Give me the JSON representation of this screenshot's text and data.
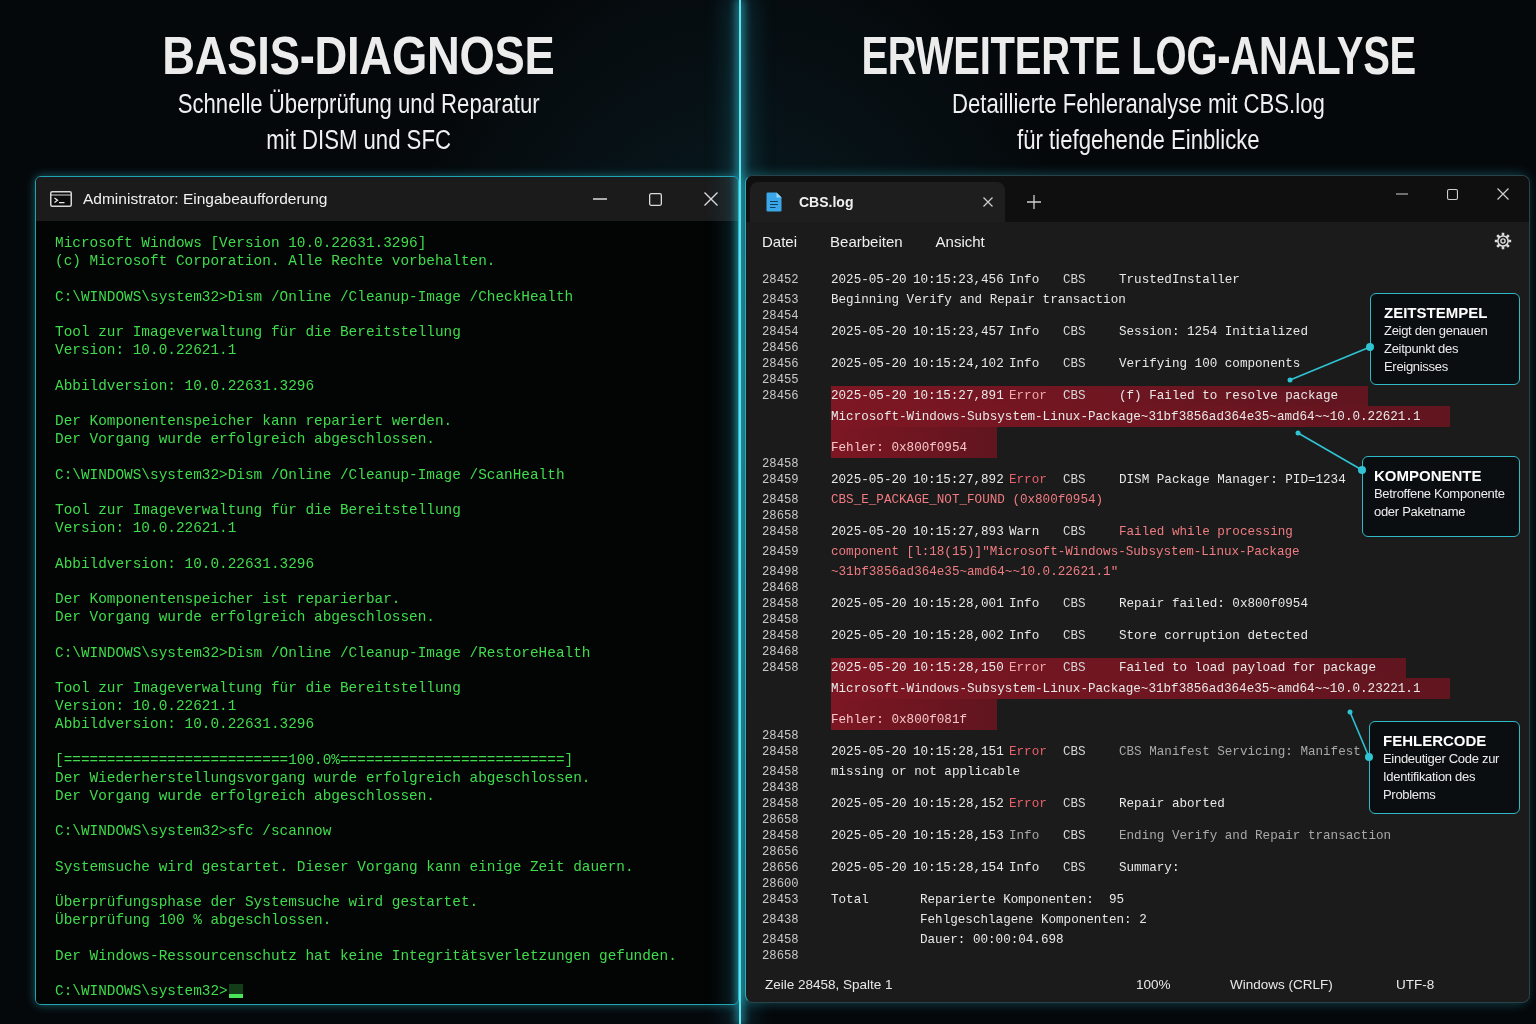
{
  "left_panel": {
    "heading": "BASIS-DIAGNOSE",
    "subheading": "Schnelle Überprüfung und Reparatur\nmit DISM und SFC",
    "terminal": {
      "title": "Administrator: Eingabeaufforderung",
      "cursor": true,
      "blocks": [
        [
          "Microsoft Windows [Version 10.0.22631.3296]",
          "(c) Microsoft Corporation. Alle Rechte vorbehalten."
        ],
        [
          "C:\\WINDOWS\\system32>Dism /Online /Cleanup-Image /CheckHealth"
        ],
        [
          "Tool zur Imageverwaltung für die Bereitstellung",
          "Version: 10.0.22621.1"
        ],
        [
          "Abbildversion: 10.0.22631.3296"
        ],
        [
          "Der Komponentenspeicher kann repariert werden.",
          "Der Vorgang wurde erfolgreich abgeschlossen."
        ],
        [
          "C:\\WINDOWS\\system32>Dism /Online /Cleanup-Image /ScanHealth"
        ],
        [
          "Tool zur Imageverwaltung für die Bereitstellung",
          "Version: 10.0.22621.1"
        ],
        [
          "Abbildversion: 10.0.22631.3296"
        ],
        [
          "Der Komponentenspeicher ist reparierbar.",
          "Der Vorgang wurde erfolgreich abgeschlossen."
        ],
        [
          "C:\\WINDOWS\\system32>Dism /Online /Cleanup-Image /RestoreHealth"
        ],
        [
          "Tool zur Imageverwaltung für die Bereitstellung",
          "Version: 10.0.22621.1",
          "Abbildversion: 10.0.22631.3296"
        ],
        [
          "[==========================100.0%==========================]",
          "Der Wiederherstellungsvorgang wurde erfolgreich abgeschlossen.",
          "Der Vorgang wurde erfolgreich abgeschlossen."
        ],
        [
          "C:\\WINDOWS\\system32>sfc /scannow"
        ],
        [
          "Systemsuche wird gestartet. Dieser Vorgang kann einige Zeit dauern."
        ],
        [
          "Überprüfungsphase der Systemsuche wird gestartet.",
          "Überprüfung 100 % abgeschlossen."
        ],
        [
          "Der Windows-Ressourcenschutz hat keine Integritätsverletzungen gefunden."
        ],
        [
          "C:\\WINDOWS\\system32>"
        ]
      ]
    }
  },
  "right_panel": {
    "heading": "ERWEITERTE LOG-ANALYSE",
    "subheading": "Detaillierte Fehleranalyse mit CBS.log\nfür tiefgehende Einblicke",
    "editor": {
      "tabs": [
        {
          "label": "CBS.log",
          "selected": true
        }
      ],
      "menu": [
        "Datei",
        "Bearbeiten",
        "Ansicht"
      ],
      "rows": [
        {
          "line": "28452",
          "kind": "entry",
          "date": "2025-05-20",
          "time": "10:15:23,456",
          "severity": "Info",
          "source": "CBS",
          "message": "TrustedInstaller",
          "error": false,
          "alert": false,
          "dimmed": false,
          "highlighted": false
        },
        {
          "line": "28453",
          "kind": "text",
          "text": "Beginning Verify and Repair transaction",
          "alert": false,
          "dimmed": false,
          "highlighted": false
        },
        {
          "line": "28454",
          "kind": "blank",
          "highlighted": false
        },
        {
          "line": "28454",
          "kind": "entry",
          "date": "2025-05-20",
          "time": "10:15:23,457",
          "severity": "Info",
          "source": "CBS",
          "message": "Session: 1254 Initialized",
          "error": false,
          "alert": false,
          "dimmed": false,
          "highlighted": false
        },
        {
          "line": "28456",
          "kind": "blank",
          "highlighted": false
        },
        {
          "line": "28456",
          "kind": "entry",
          "date": "2025-05-20",
          "time": "10:15:24,102",
          "severity": "Info",
          "source": "CBS",
          "message": "Verifying 100 components",
          "error": false,
          "alert": false,
          "dimmed": false,
          "highlighted": false
        },
        {
          "line": "28455",
          "kind": "blank",
          "highlighted": false
        },
        {
          "line": "28456",
          "kind": "entry",
          "date": "2025-05-20",
          "time": "10:15:27,891",
          "severity": "Error",
          "source": "CBS",
          "message": "(f) Failed to resolve package",
          "error": true,
          "alert": false,
          "dimmed": false,
          "highlighted": true
        },
        {
          "kind": "text",
          "text": "Microsoft-Windows-Subsystem-Linux-Package~31bf3856ad364e35~amd64~~10.0.22621.1",
          "alert": false,
          "dimmed": false,
          "highlighted": true
        },
        {
          "kind": "text",
          "text": "Fehler: 0x800f0954",
          "alert": true,
          "dimmed": false,
          "highlighted": true
        },
        {
          "line": "28458",
          "kind": "blank",
          "highlighted": false
        },
        {
          "line": "28459",
          "kind": "entry",
          "date": "2025-05-20",
          "time": "10:15:27,892",
          "severity": "Error",
          "source": "CBS",
          "message": "DISM Package Manager: PID=1234",
          "error": true,
          "alert": false,
          "dimmed": false,
          "highlighted": false
        },
        {
          "line": "28458",
          "kind": "text",
          "text": "CBS_E_PACKAGE_NOT_FOUND (0x800f0954)",
          "alert": true,
          "dimmed": false,
          "highlighted": false
        },
        {
          "line": "28658",
          "kind": "blank",
          "highlighted": false
        },
        {
          "line": "28458",
          "kind": "entry",
          "date": "2025-05-20",
          "time": "10:15:27,893",
          "severity": "Warn",
          "source": "CBS",
          "message": "Failed while processing",
          "error": false,
          "alert": true,
          "dimmed": false,
          "highlighted": false
        },
        {
          "line": "28459",
          "kind": "text",
          "text": "component [l:18(15)]\"Microsoft-Windows-Subsystem-Linux-Package",
          "alert": true,
          "dimmed": false,
          "highlighted": false
        },
        {
          "line": "28498",
          "kind": "text",
          "text": "~31bf3856ad364e35~amd64~~10.0.22621.1\"",
          "alert": true,
          "dimmed": false,
          "highlighted": false
        },
        {
          "line": "28468",
          "kind": "blank",
          "highlighted": false
        },
        {
          "line": "28458",
          "kind": "entry",
          "date": "2025-05-20",
          "time": "10:15:28,001",
          "severity": "Info",
          "source": "CBS",
          "message": "Repair failed: 0x800f0954",
          "error": false,
          "alert": false,
          "dimmed": false,
          "highlighted": false
        },
        {
          "line": "28458",
          "kind": "blank",
          "highlighted": false
        },
        {
          "line": "28458",
          "kind": "entry",
          "date": "2025-05-20",
          "time": "10:15:28,002",
          "severity": "Info",
          "source": "CBS",
          "message": "Store corruption detected",
          "error": false,
          "alert": false,
          "dimmed": false,
          "highlighted": false
        },
        {
          "line": "28468",
          "kind": "blank",
          "highlighted": false
        },
        {
          "line": "28458",
          "kind": "entry",
          "date": "2025-05-20",
          "time": "10:15:28,150",
          "severity": "Error",
          "source": "CBS",
          "message": "Failed to load payload for package",
          "error": true,
          "alert": false,
          "dimmed": false,
          "highlighted": true
        },
        {
          "kind": "text",
          "text": "Microsoft-Windows-Subsystem-Linux-Package~31bf3856ad364e35~amd64~~10.0.23221.1",
          "alert": false,
          "dimmed": false,
          "highlighted": true
        },
        {
          "kind": "text",
          "text": "Fehler: 0x800f081f",
          "alert": true,
          "dimmed": false,
          "highlighted": true
        },
        {
          "line": "28458",
          "kind": "blank",
          "highlighted": false
        },
        {
          "line": "28458",
          "kind": "entry",
          "date": "2025-05-20",
          "time": "10:15:28,151",
          "severity": "Error",
          "source": "CBS",
          "message": "CBS Manifest Servicing: Manifest",
          "error": true,
          "alert": false,
          "dimmed": true,
          "highlighted": false
        },
        {
          "line": "28458",
          "kind": "text",
          "text": "missing or not applicable",
          "alert": false,
          "dimmed": false,
          "highlighted": false
        },
        {
          "line": "28438",
          "kind": "blank",
          "highlighted": false
        },
        {
          "line": "28458",
          "kind": "entry",
          "date": "2025-05-20",
          "time": "10:15:28,152",
          "severity": "Error",
          "source": "CBS",
          "message": "Repair aborted",
          "error": true,
          "alert": false,
          "dimmed": false,
          "highlighted": false
        },
        {
          "line": "28658",
          "kind": "blank",
          "highlighted": false
        },
        {
          "line": "28458",
          "kind": "entry",
          "date": "2025-05-20",
          "time": "10:15:28,153",
          "severity": "Info",
          "source": "CBS",
          "message": "Ending Verify and Repair transaction",
          "error": false,
          "alert": false,
          "dimmed": true,
          "highlighted": false
        },
        {
          "line": "28656",
          "kind": "blank",
          "highlighted": false
        },
        {
          "line": "28656",
          "kind": "entry",
          "date": "2025-05-20",
          "time": "10:15:28,154",
          "severity": "Info",
          "source": "CBS",
          "message": "Summary:",
          "error": false,
          "alert": false,
          "dimmed": false,
          "highlighted": false
        },
        {
          "line": "28600",
          "kind": "blank",
          "highlighted": false
        },
        {
          "line": "28453",
          "kind": "summary",
          "label": "Total",
          "text": "Reparierte Komponenten:  95",
          "alert": false,
          "dimmed": false,
          "highlighted": false
        },
        {
          "line": "28438",
          "kind": "summary",
          "text": "Fehlgeschlagene Komponenten: 2",
          "alert": false,
          "dimmed": false,
          "highlighted": false
        },
        {
          "line": "28458",
          "kind": "summary",
          "text": "Dauer: 00:00:04.698",
          "alert": false,
          "dimmed": false,
          "highlighted": false
        },
        {
          "line": "28658",
          "kind": "blank",
          "highlighted": false
        }
      ],
      "status_bar": {
        "position": "Zeile 28458, Spalte 1",
        "zoom": "100%",
        "line_ending": "Windows (CRLF)",
        "encoding": "UTF-8"
      }
    },
    "callouts": [
      {
        "title": "ZEITSTEMPEL",
        "text": "Zeigt den genauen Zeitpunkt des Ereignisses"
      },
      {
        "title": "KOMPONENTE",
        "text": "Betroffene Komponente oder Paketname"
      },
      {
        "title": "FEHLERCODE",
        "text": "Eindeutiger Code zur Identifikation des Problems"
      }
    ]
  }
}
